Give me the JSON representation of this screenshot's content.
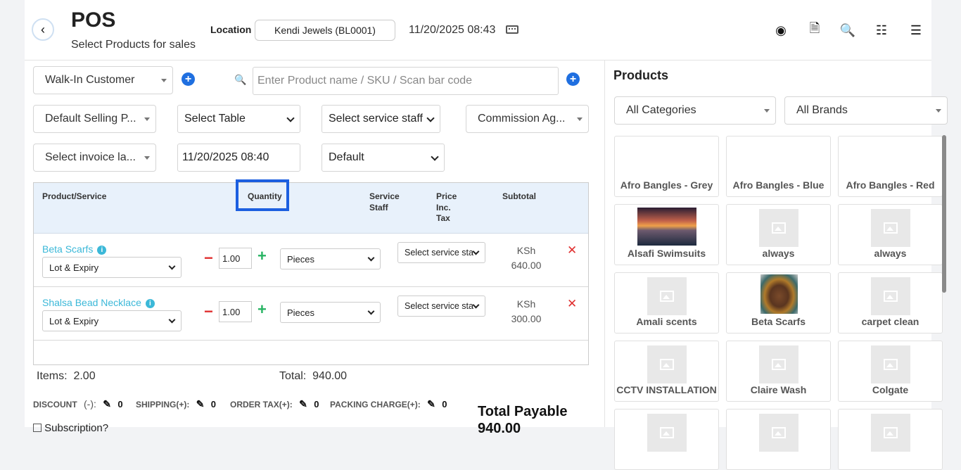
{
  "header": {
    "title": "POS",
    "subtitle": "Select Products for sales",
    "location_label": "Location",
    "location_value": "Kendi Jewels (BL0001)",
    "datetime": "11/20/2025 08:43"
  },
  "form": {
    "customer": "Walk-In Customer",
    "search_placeholder": "Enter Product name / SKU / Scan bar code",
    "price_group": "Default Selling P...",
    "table": "Select Table",
    "service_staff": "Select service staff",
    "commission_agent": "Commission Ag...",
    "invoice_layout": "Select invoice la...",
    "transaction_date": "11/20/2025 08:40",
    "invoice_scheme": "Default"
  },
  "table": {
    "headers": {
      "product": "Product/Service",
      "quantity": "Quantity",
      "service_staff": [
        "Service",
        "Staff"
      ],
      "price": [
        "Price",
        "Inc.",
        "Tax"
      ],
      "subtotal": "Subtotal"
    },
    "rows": [
      {
        "name": "Beta Scarfs",
        "lot": "Lot & Expiry",
        "qty": "1.00",
        "unit": "Pieces",
        "staff": "Select service sta",
        "currency": "KSh",
        "subtotal": "640.00"
      },
      {
        "name": "Shalsa Bead Necklace",
        "lot": "Lot & Expiry",
        "qty": "1.00",
        "unit": "Pieces",
        "staff": "Select service sta",
        "currency": "KSh",
        "subtotal": "300.00"
      }
    ]
  },
  "summary": {
    "items_label": "Items:",
    "items_value": "2.00",
    "total_label": "Total:",
    "total_value": "940.00",
    "discount_label": "DISCOUNT",
    "discount_sign": "(-):",
    "discount_value": "0",
    "shipping_label": "SHIPPING(+):",
    "shipping_value": "0",
    "order_tax_label": "ORDER TAX(+):",
    "order_tax_value": "0",
    "packing_label": "PACKING CHARGE(+):",
    "packing_value": "0",
    "total_payable_label": "Total Payable",
    "total_payable_value": "940.00",
    "subscription_label": "Subscription?"
  },
  "products": {
    "title": "Products",
    "category_filter": "All Categories",
    "brand_filter": "All Brands",
    "items": [
      {
        "name": "Afro Bangles - Grey",
        "image": "none"
      },
      {
        "name": "Afro Bangles - Blue",
        "image": "none"
      },
      {
        "name": "Afro Bangles - Red",
        "image": "none"
      },
      {
        "name": "Alsafi Swimsuits",
        "image": "sunset-photo"
      },
      {
        "name": "always",
        "image": "placeholder"
      },
      {
        "name": "always",
        "image": "placeholder"
      },
      {
        "name": "Amali scents",
        "image": "placeholder"
      },
      {
        "name": "Beta Scarfs",
        "image": "portrait-photo"
      },
      {
        "name": "carpet clean",
        "image": "placeholder"
      },
      {
        "name": "CCTV INSTALLATION",
        "image": "placeholder"
      },
      {
        "name": "Claire Wash",
        "image": "placeholder"
      },
      {
        "name": "Colgate",
        "image": "placeholder"
      }
    ]
  },
  "colors": {
    "accent": "#1f6fe0",
    "link": "#3bb8d8",
    "remove": "#e03030",
    "add": "#28b463",
    "highlight": "#1c5fe0"
  }
}
